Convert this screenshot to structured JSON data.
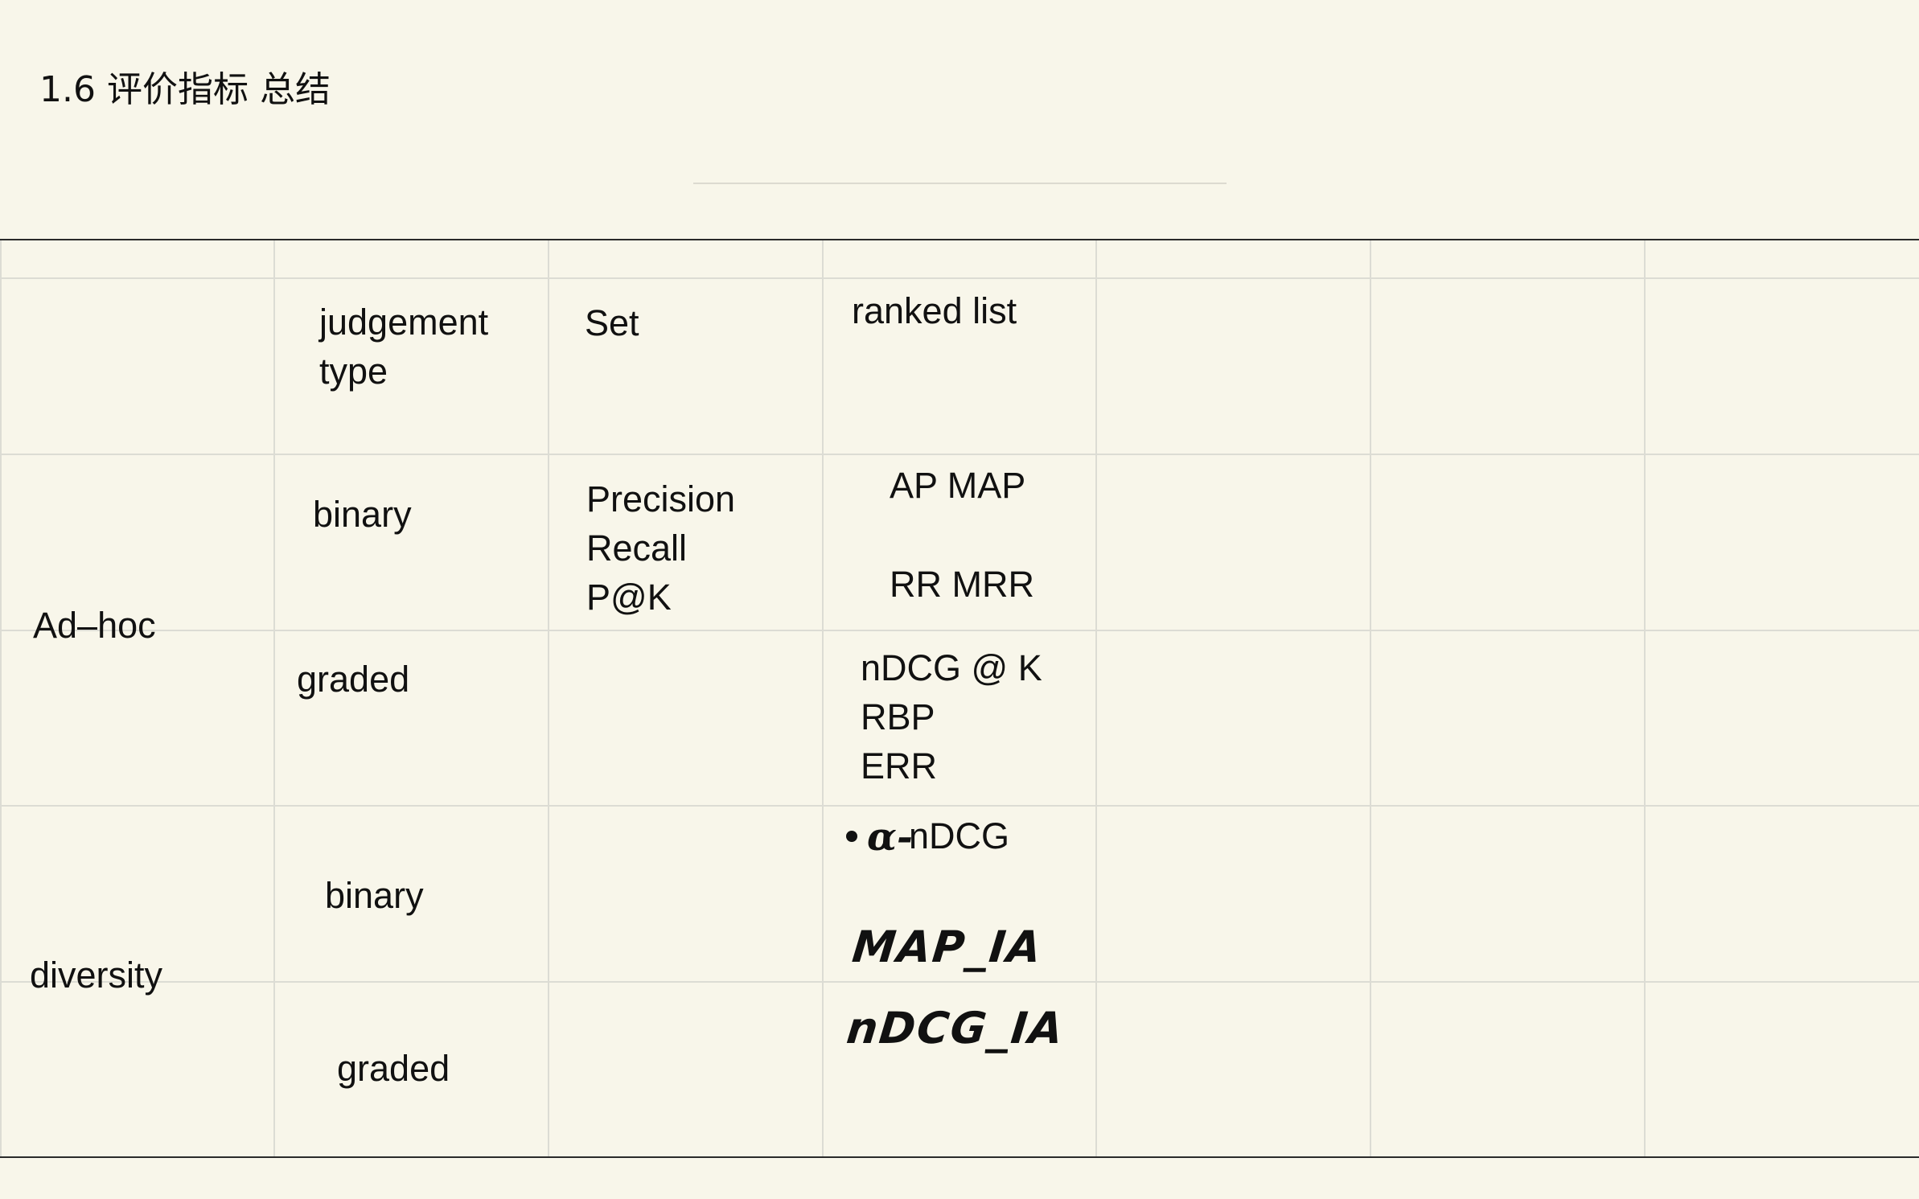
{
  "title": "1.6 评价指标 总结",
  "table": {
    "header": {
      "judgement_type": "judgement\ntype",
      "set": "Set",
      "ranked_list": "ranked list"
    },
    "groups": [
      {
        "name": "Ad–hoc",
        "rows": [
          {
            "judgement": "binary",
            "set": "Precision\nRecall\nP@K",
            "ranked": [
              "AP MAP",
              "RR MRR"
            ]
          },
          {
            "judgement": "graded",
            "set": "",
            "ranked": [
              "nDCG @ K\nRBP\nERR"
            ]
          }
        ]
      },
      {
        "name": "diversity",
        "rows": [
          {
            "judgement": "binary",
            "set": "",
            "ranked_bullet_prefix": "α-",
            "ranked_bullet_text": "nDCG",
            "ranked_handwritten": "MAP_IA"
          },
          {
            "judgement": "graded",
            "set": "",
            "ranked_handwritten": "nDCG_IA"
          }
        ]
      }
    ]
  }
}
